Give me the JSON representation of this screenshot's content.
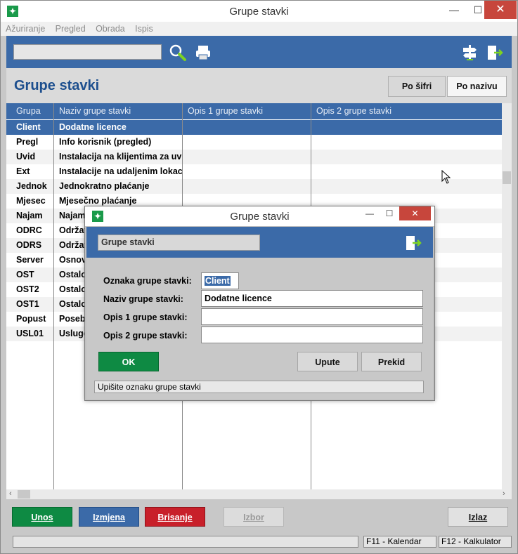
{
  "window": {
    "title": "Grupe stavki",
    "minimize": "—",
    "maximize": "☐",
    "close": "✕"
  },
  "menu": [
    "Ažuriranje",
    "Pregled",
    "Obrada",
    "Ispis"
  ],
  "toolbar": {
    "search_value": ""
  },
  "header": {
    "title": "Grupe stavki",
    "sort_by_code": "Po šifri",
    "sort_by_name": "Po nazivu"
  },
  "columns": [
    "Grupa",
    "Naziv grupe stavki",
    "Opis 1 grupe stavki",
    "Opis 2 grupe stavki"
  ],
  "rows": [
    {
      "code": "Client",
      "name": "Dodatne licence"
    },
    {
      "code": "Pregl",
      "name": "Info korisnik (pregled)"
    },
    {
      "code": "Uvid",
      "name": "Instalacija na klijentima za uvid"
    },
    {
      "code": "Ext",
      "name": "Instalacije na udaljenim lokacijama"
    },
    {
      "code": "Jednok",
      "name": "Jednokratno plaćanje"
    },
    {
      "code": "Mjesec",
      "name": "Mjesečno plaćanje"
    },
    {
      "code": "Najam",
      "name": "Najam"
    },
    {
      "code": "ODRC",
      "name": "Održav"
    },
    {
      "code": "ODRS",
      "name": "Održav"
    },
    {
      "code": "Server",
      "name": "Osnov"
    },
    {
      "code": "OST",
      "name": "Ostalo"
    },
    {
      "code": "OST2",
      "name": "Ostalo"
    },
    {
      "code": "OST1",
      "name": "Ostalo"
    },
    {
      "code": "Popust",
      "name": "Posebi"
    },
    {
      "code": "USL01",
      "name": "Usluge"
    }
  ],
  "buttons": {
    "unos": "Unos",
    "izmjena": "Izmjena",
    "brisanje": "Brisanje",
    "izbor": "Izbor",
    "izlaz": "Izlaz"
  },
  "statusbar": {
    "f11": "F11 - Kalendar",
    "f12": "F12 - Kalkulator"
  },
  "dialog": {
    "title": "Grupe stavki",
    "caption": "Grupe stavki",
    "fields": [
      {
        "label": "Oznaka grupe stavki:",
        "value": "Client"
      },
      {
        "label": "Naziv grupe stavki:",
        "value": "Dodatne licence"
      },
      {
        "label": "Opis 1 grupe stavki:",
        "value": ""
      },
      {
        "label": "Opis 2 grupe stavki:",
        "value": ""
      }
    ],
    "ok": "OK",
    "upute": "Upute",
    "prekid": "Prekid",
    "status": "Upišite oznaku grupe stavki"
  },
  "colors": {
    "blue": "#3b6aa8",
    "green": "#0e8a43",
    "red": "#c8202a",
    "close_red": "#c7463c"
  }
}
